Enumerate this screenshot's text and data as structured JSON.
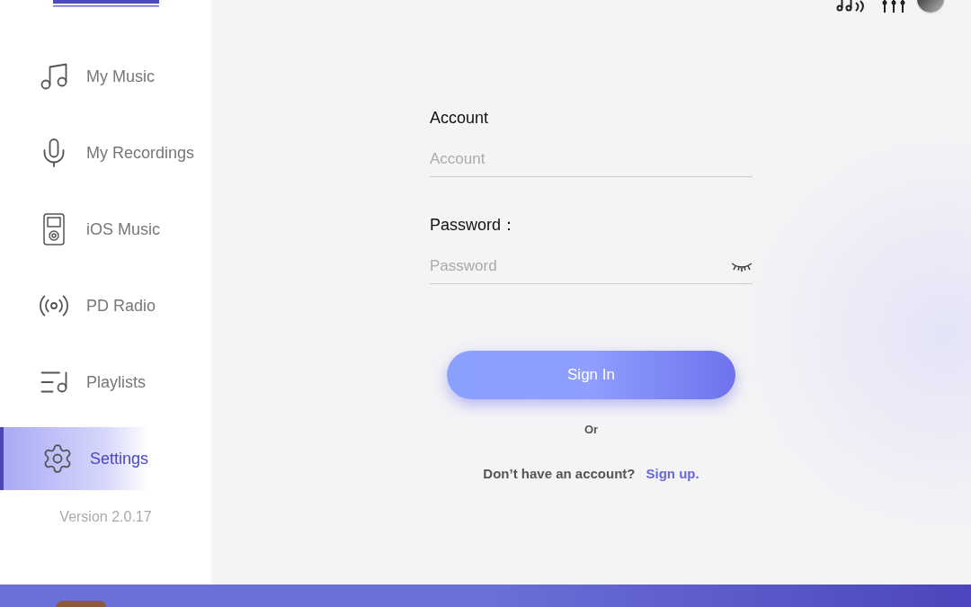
{
  "sidebar": {
    "items": [
      {
        "label": "My Music",
        "kind": "music",
        "selected": false
      },
      {
        "label": "My Recordings",
        "kind": "mic",
        "selected": false
      },
      {
        "label": "iOS Music",
        "kind": "player",
        "selected": false
      },
      {
        "label": "PD Radio",
        "kind": "radio",
        "selected": false
      },
      {
        "label": "Playlists",
        "kind": "playlist",
        "selected": false
      },
      {
        "label": "Settings",
        "kind": "settings",
        "selected": true
      }
    ],
    "version": "Version 2.0.17"
  },
  "form": {
    "account_label": "Account",
    "account_placeholder": "Account",
    "password_label": "Password：",
    "password_placeholder": "Password",
    "sign_in": "Sign In",
    "or": "Or",
    "no_account": "Don’t have an account?",
    "sign_up": "Sign up."
  }
}
